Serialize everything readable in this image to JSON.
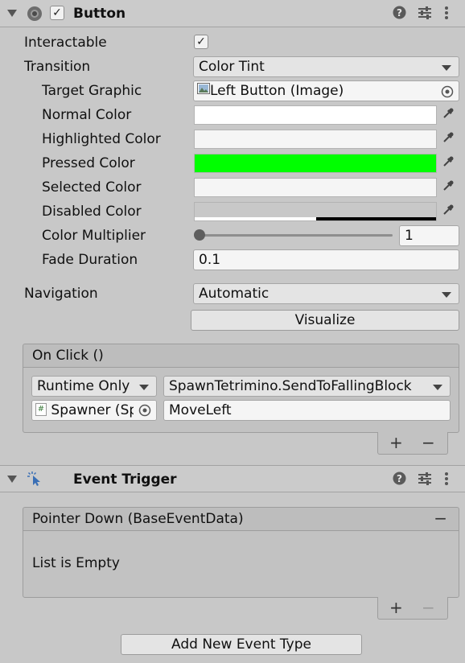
{
  "button_component": {
    "title": "Button",
    "enabled": true,
    "interactable_label": "Interactable",
    "interactable_checked": true,
    "transition_label": "Transition",
    "transition_value": "Color Tint",
    "target_graphic_label": "Target Graphic",
    "target_graphic_value": "Left Button (Image)",
    "normal_color_label": "Normal Color",
    "normal_color": "#ffffff",
    "highlighted_color_label": "Highlighted Color",
    "highlighted_color": "#f5f5f5",
    "pressed_color_label": "Pressed Color",
    "pressed_color": "#00ff00",
    "selected_color_label": "Selected Color",
    "selected_color": "#f5f5f5",
    "disabled_color_label": "Disabled Color",
    "disabled_color": "#c8c8c8",
    "color_multiplier_label": "Color Multiplier",
    "color_multiplier_value": "1",
    "fade_duration_label": "Fade Duration",
    "fade_duration_value": "0.1",
    "navigation_label": "Navigation",
    "navigation_value": "Automatic",
    "visualize_label": "Visualize",
    "on_click": {
      "header": "On Click ()",
      "runtime_value": "Runtime Only",
      "function_value": "SpawnTetrimino.SendToFallingBlock",
      "object_value": "Spawner (Sp",
      "argument_value": "MoveLeft",
      "add_label": "+",
      "remove_label": "−"
    }
  },
  "event_trigger": {
    "title": "Event Trigger",
    "entry_header": "Pointer Down (BaseEventData)",
    "entry_remove_label": "−",
    "empty_text": "List is Empty",
    "add_label": "+",
    "remove_label": "−",
    "add_event_label": "Add New Event Type"
  },
  "icons": [
    "foldout-icon",
    "radio-icon",
    "help-icon",
    "presets-icon",
    "kebab-menu-icon",
    "image-icon",
    "object-picker-icon",
    "eyedropper-icon",
    "script-icon",
    "event-trigger-icon"
  ]
}
